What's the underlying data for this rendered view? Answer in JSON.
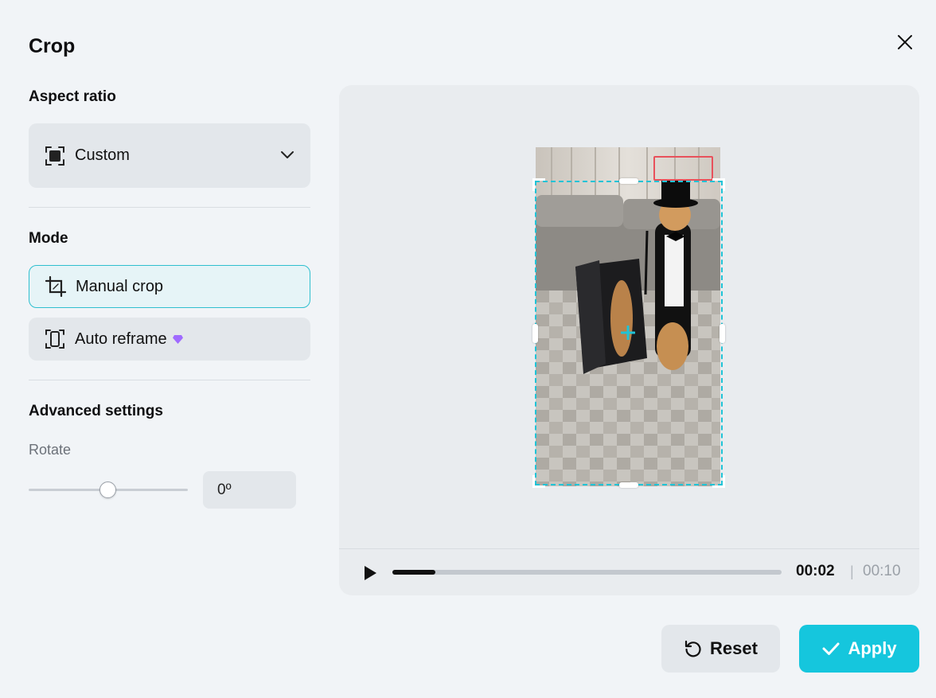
{
  "dialog": {
    "title": "Crop"
  },
  "aspect_ratio": {
    "heading": "Aspect ratio",
    "selected": "Custom"
  },
  "mode": {
    "heading": "Mode",
    "options": [
      {
        "label": "Manual crop",
        "active": true
      },
      {
        "label": "Auto reframe",
        "premium": true
      }
    ]
  },
  "advanced": {
    "heading": "Advanced settings",
    "rotate_label": "Rotate",
    "rotate_value": "0º",
    "rotate_slider_fraction": 0.5
  },
  "player": {
    "current_time": "00:02",
    "separator": "|",
    "total_time": "00:10",
    "progress_fraction": 0.11
  },
  "actions": {
    "reset_label": "Reset",
    "apply_label": "Apply"
  },
  "colors": {
    "accent": "#15c6dd",
    "crop_border": "#1fc3d6",
    "highlight": "#e8515b",
    "premium": "#a06bff"
  },
  "icons": [
    "close-icon",
    "aspect-ratio-icon",
    "chevron-down-icon",
    "crop-icon",
    "reframe-icon",
    "diamond-icon",
    "play-icon",
    "reset-icon",
    "check-icon"
  ]
}
